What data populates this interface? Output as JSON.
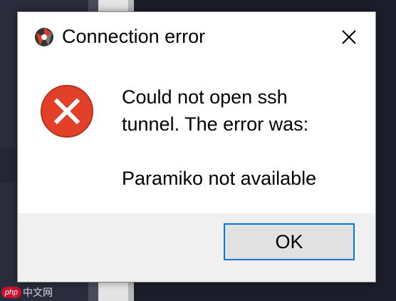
{
  "dialog": {
    "title": "Connection error",
    "app_icon": "app-logo-icon",
    "close_icon": "close-icon",
    "error_icon": "error-icon",
    "message_lines": [
      "Could not open ssh",
      "tunnel. The error was:"
    ],
    "detail": "Paramiko not available",
    "ok_label": "OK"
  },
  "watermark": {
    "logo": "php",
    "text": "中文网"
  },
  "colors": {
    "error_red": "#e3402a",
    "button_focus": "#0078d7",
    "footer_bg": "#f0f0f0"
  }
}
